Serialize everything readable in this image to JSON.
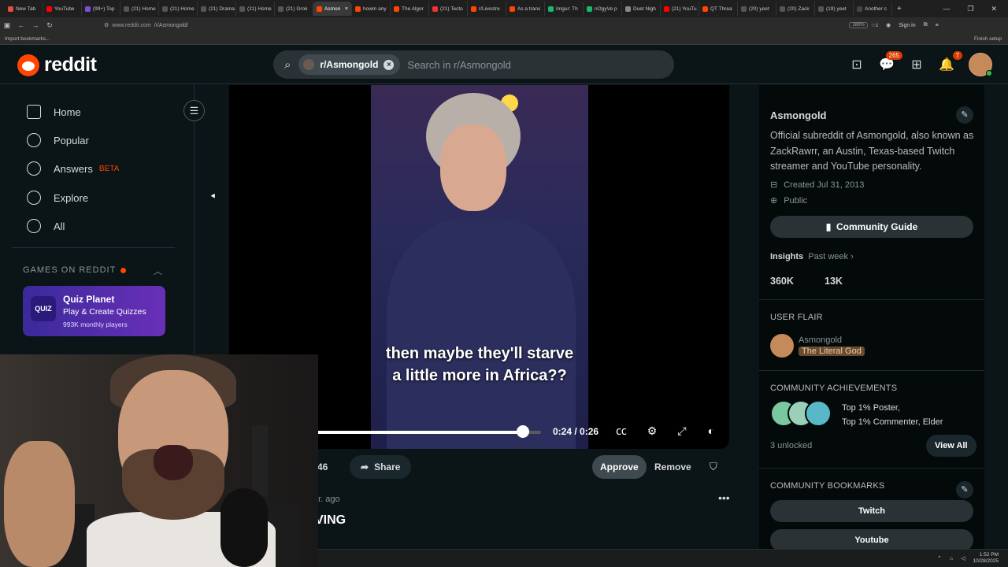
{
  "browser": {
    "tabs": [
      {
        "label": "New Tab",
        "color": "#e74c3c"
      },
      {
        "label": "YouTube",
        "color": "#ff0000"
      },
      {
        "label": "(99+) Top",
        "color": "#7b4fd6"
      },
      {
        "label": "(21) Home",
        "color": "#555555"
      },
      {
        "label": "(21) Home",
        "color": "#555555"
      },
      {
        "label": "(21) Drama",
        "color": "#555555"
      },
      {
        "label": "(21) Home",
        "color": "#555555"
      },
      {
        "label": "(21) Grok",
        "color": "#555555"
      },
      {
        "label": "Asmon",
        "color": "#ff4500",
        "active": true
      },
      {
        "label": "howm any",
        "color": "#ff4500"
      },
      {
        "label": "The Algor",
        "color": "#ff4500"
      },
      {
        "label": "(21) Tecto",
        "color": "#e33"
      },
      {
        "label": "r/Livestre",
        "color": "#ff4500"
      },
      {
        "label": "As a trans",
        "color": "#ff4500"
      },
      {
        "label": "Imgur: Th",
        "color": "#1bb76e"
      },
      {
        "label": "nOgyVe p",
        "color": "#1bb76e"
      },
      {
        "label": "Duet Nigh",
        "color": "#888888"
      },
      {
        "label": "(21) YouTu",
        "color": "#ff0000"
      },
      {
        "label": "QT Threa",
        "color": "#ff4500"
      },
      {
        "label": "(20) yeet",
        "color": "#555555"
      },
      {
        "label": "(20) Zack",
        "color": "#555555"
      },
      {
        "label": "(19) yeet",
        "color": "#555555"
      },
      {
        "label": "Another c",
        "color": "#444444"
      }
    ],
    "url_host": "www.reddit.com",
    "url_path": "/r/Asmongold/",
    "zoom": "180%",
    "sign_in": "Sign in",
    "bookmarks_label": "Import bookmarks...",
    "finish_setup": "Finish setup"
  },
  "header": {
    "logo_text": "reddit",
    "search_chip": "r/Asmongold",
    "search_placeholder": "Search in r/Asmongold",
    "chat_badge": "265",
    "notif_badge": "7"
  },
  "sidebar": {
    "items": [
      {
        "label": "Home",
        "icon": "home-icon"
      },
      {
        "label": "Popular",
        "icon": "popular-icon"
      },
      {
        "label": "Answers",
        "icon": "answers-icon",
        "tag": "BETA"
      },
      {
        "label": "Explore",
        "icon": "explore-icon"
      },
      {
        "label": "All",
        "icon": "all-icon"
      }
    ],
    "games_heading": "GAMES ON REDDIT",
    "game": {
      "icon_text": "QUIZ",
      "title": "Quiz Planet",
      "subtitle": "Play & Create Quizzes",
      "meta": "993K monthly players"
    }
  },
  "video": {
    "caption_line1": "then maybe they'll starve",
    "caption_line2": "a little more in Africa??",
    "time": "0:24 / 0:26",
    "progress": 0.92
  },
  "post": {
    "votes": "46",
    "share_label": "Share",
    "approve_label": "Approve",
    "remove_label": "Remove",
    "time_partial": "ar. ago",
    "title_partial": "VING"
  },
  "community": {
    "name": "Asmongold",
    "description": "Official subreddit of Asmongold, also known as ZackRawrr, an Austin, Texas-based Twitch streamer and YouTube personality.",
    "created": "Created Jul 31, 2013",
    "visibility": "Public",
    "guide_label": "Community Guide",
    "insights_label": "Insights",
    "insights_period": "Past week",
    "stat1": "360K",
    "stat2": "13K",
    "flair_heading": "USER FLAIR",
    "flair_name": "Asmongold",
    "flair_tag": "The Literal God",
    "achievements_heading": "COMMUNITY ACHIEVEMENTS",
    "achievement_line1": "Top 1% Poster,",
    "achievement_line2": "Top 1% Commenter, Elder",
    "unlocked": "3 unlocked",
    "view_all": "View All",
    "bookmarks_heading": "COMMUNITY BOOKMARKS",
    "bookmark1": "Twitch",
    "bookmark2": "Youtube"
  },
  "taskbar": {
    "time": "1:52 PM",
    "date": "10/28/2025"
  }
}
